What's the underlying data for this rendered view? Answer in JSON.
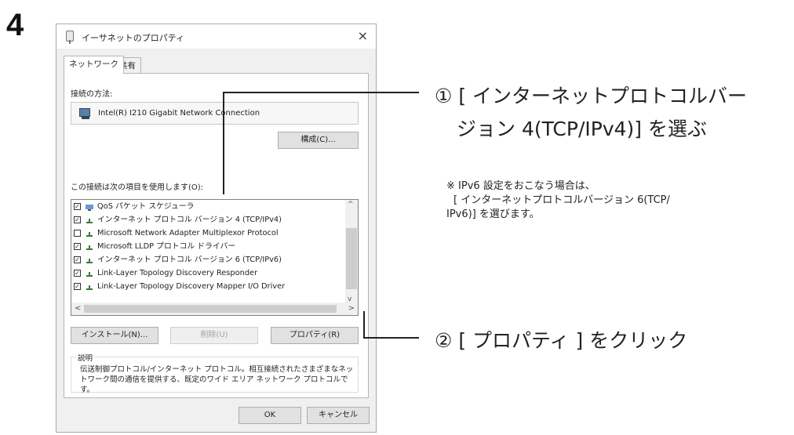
{
  "step_number": "4",
  "dialog": {
    "title": "イーサネットのプロパティ",
    "close_glyph": "×",
    "tabs": [
      {
        "label": "ネットワーク",
        "active": true
      },
      {
        "label": "共有",
        "active": false
      }
    ],
    "connect_using_label": "接続の方法:",
    "adapter_name": "Intel(R) I210 Gigabit Network Connection",
    "configure_button": "構成(C)...",
    "items_label": "この接続は次の項目を使用します(O):",
    "items": [
      {
        "checked": true,
        "icon": "qos-scheduler-icon",
        "label": "QoS パケット スケジューラ"
      },
      {
        "checked": true,
        "icon": "protocol-icon",
        "label": "インターネット プロトコル バージョン 4 (TCP/IPv4)"
      },
      {
        "checked": false,
        "icon": "protocol-icon",
        "label": "Microsoft Network Adapter Multiplexor Protocol"
      },
      {
        "checked": true,
        "icon": "protocol-icon",
        "label": "Microsoft LLDP プロトコル ドライバー"
      },
      {
        "checked": true,
        "icon": "protocol-icon",
        "label": "インターネット プロトコル バージョン 6 (TCP/IPv6)"
      },
      {
        "checked": true,
        "icon": "protocol-icon",
        "label": "Link-Layer Topology Discovery Responder"
      },
      {
        "checked": true,
        "icon": "protocol-icon",
        "label": "Link-Layer Topology Discovery Mapper I/O Driver"
      }
    ],
    "install_button": "インストール(N)...",
    "uninstall_button": "削除(U)",
    "properties_button": "プロパティ(R)",
    "description_title": "説明",
    "description_text": "伝送制御プロトコル/インターネット プロトコル。相互接続されたさまざまなネットワーク間の通信を提供する、既定のワイド エリア ネットワーク プロトコルです。",
    "ok_button": "OK",
    "cancel_button": "キャンセル"
  },
  "callouts": {
    "step1_line1": "① [ インターネットプロトコルバー",
    "step1_line2": "ジョン 4(TCP/IPv4)] を選ぶ",
    "note_line1": "※ IPv6 設定をおこなう場合は、",
    "note_line2": "[ インターネットプロトコルバージョン 6(TCP/",
    "note_line3": "IPv6)] を選びます。",
    "step2": "② [ プロパティ ] をクリック"
  }
}
